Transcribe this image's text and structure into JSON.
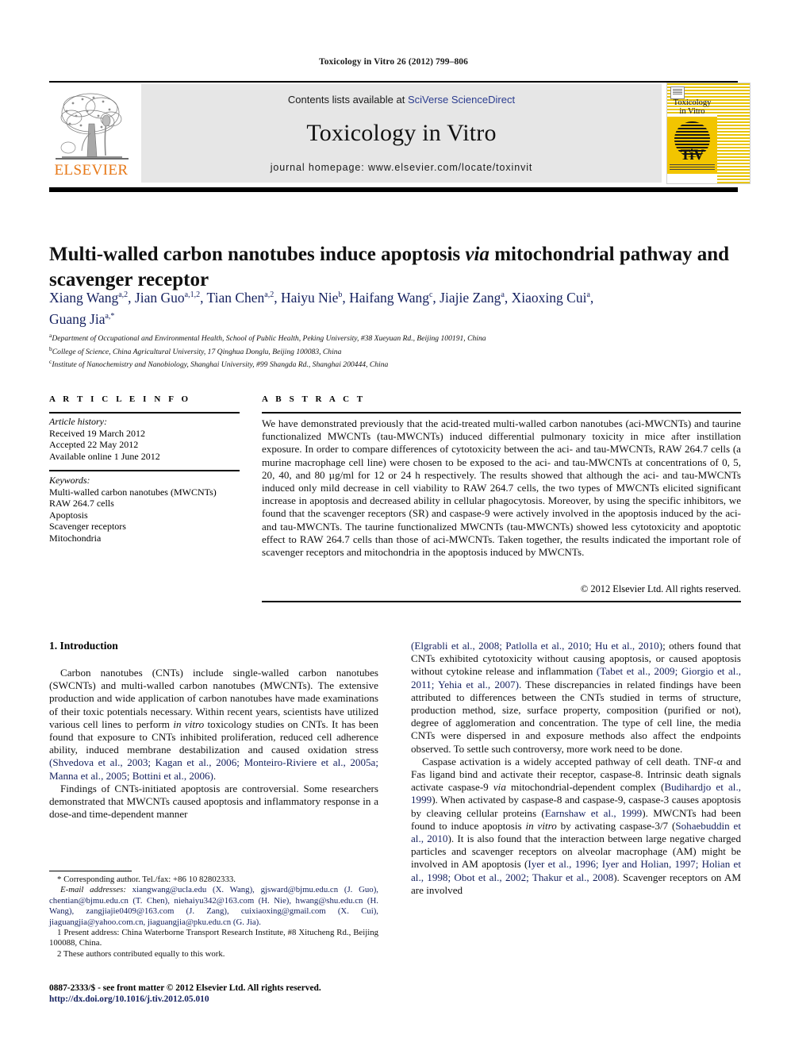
{
  "running_head": "Toxicology in Vitro 26 (2012) 799–806",
  "masthead": {
    "contents_prefix": "Contents lists available at ",
    "contents_link": "SciVerse ScienceDirect",
    "journal_title": "Toxicology in Vitro",
    "homepage": "journal homepage: www.elsevier.com/locate/toxinvit",
    "publisher_logo_text": "ELSEVIER",
    "cover": {
      "title_line1": "Toxicology",
      "title_line2": "in Vitro",
      "logo_text": "TiV"
    }
  },
  "article": {
    "title_part1": "Multi-walled carbon nanotubes induce apoptosis ",
    "title_italic": "via",
    "title_part2": " mitochondrial pathway and scavenger receptor",
    "authors_line1": "Xiang Wang a,2, Jian Guo a,1,2, Tian Chen a,2, Haiyu Nie b, Haifang Wang c, Jiajie Zang a, Xiaoxing Cui a,",
    "authors_line2": "Guang Jia a,*",
    "affiliations": [
      "a Department of Occupational and Environmental Health, School of Public Health, Peking University, #38 Xueyuan Rd., Beijing 100191, China",
      "b College of Science, China Agricultural University, 17 Qinghua Donglu, Beijing 100083, China",
      "c Institute of Nanochemistry and Nanobiology, Shanghai University, #99 Shangda Rd., Shanghai 200444, China"
    ]
  },
  "article_info": {
    "heading": "A R T I C L E  I N F O",
    "history_label": "Article history:",
    "history": [
      "Received 19 March 2012",
      "Accepted 22 May 2012",
      "Available online 1 June 2012"
    ],
    "keywords_label": "Keywords:",
    "keywords": [
      "Multi-walled carbon nanotubes (MWCNTs)",
      "RAW 264.7 cells",
      "Apoptosis",
      "Scavenger receptors",
      "Mitochondria"
    ]
  },
  "abstract": {
    "heading": "A B S T R A C T",
    "text": "We have demonstrated previously that the acid-treated multi-walled carbon nanotubes (aci-MWCNTs) and taurine functionalized MWCNTs (tau-MWCNTs) induced differential pulmonary toxicity in mice after instillation exposure. In order to compare differences of cytotoxicity between the aci- and tau-MWCNTs, RAW 264.7 cells (a murine macrophage cell line) were chosen to be exposed to the aci- and tau-MWCNTs at concentrations of 0, 5, 20, 40, and 80 µg/ml for 12 or 24 h respectively. The results showed that although the aci- and tau-MWCNTs induced only mild decrease in cell viability to RAW 264.7 cells, the two types of MWCNTs elicited significant increase in apoptosis and decreased ability in cellular phagocytosis. Moreover, by using the specific inhibitors, we found that the scavenger receptors (SR) and caspase-9 were actively involved in the apoptosis induced by the aci- and tau-MWCNTs. The taurine functionalized MWCNTs (tau-MWCNTs) showed less cytotoxicity and apoptotic effect to RAW 264.7 cells than those of aci-MWCNTs. Taken together, the results indicated the important role of scavenger receptors and mitochondria in the apoptosis induced by MWCNTs.",
    "copyright": "© 2012 Elsevier Ltd. All rights reserved."
  },
  "body": {
    "section_heading": "1. Introduction",
    "left_p1_a": "Carbon nanotubes (CNTs) include single-walled carbon nanotubes (SWCNTs) and multi-walled carbon nanotubes (MWCNTs). The extensive production and wide application of carbon nanotubes have made examinations of their toxic potentials necessary. Within recent years, scientists have utilized various cell lines to perform ",
    "left_p1_it": "in vitro",
    "left_p1_b": " toxicology studies on CNTs. It has been found that exposure to CNTs inhibited proliferation, reduced cell adherence ability, induced membrane destabilization and caused oxidation stress ",
    "left_p1_cite": "(Shvedova et al., 2003; Kagan et al., 2006; Monteiro-Riviere et al., 2005a; Manna et al., 2005; Bottini et al., 2006)",
    "left_p1_c": ".",
    "left_p2": "Findings of CNTs-initiated apoptosis are controversial. Some researchers demonstrated that MWCNTs caused apoptosis and inflammatory response in a dose-and time-dependent manner",
    "right_p1_cite1": "(Elgrabli et al., 2008; Patlolla et al., 2010; Hu et al., 2010)",
    "right_p1_a": "; others found that CNTs exhibited cytotoxicity without causing apoptosis, or caused apoptosis without cytokine release and inflammation ",
    "right_p1_cite2": "(Tabet et al., 2009; Giorgio et al., 2011; Yehia et al., 2007)",
    "right_p1_b": ". These discrepancies in related findings have been attributed to differences between the CNTs studied in terms of structure, production method, size, surface property, composition (purified or not), degree of agglomeration and concentration. The type of cell line, the media CNTs were dispersed in and exposure methods also affect the endpoints observed. To settle such controversy, more work need to be done.",
    "right_p2_a": "Caspase activation is a widely accepted pathway of cell death. TNF-α and Fas ligand bind and activate their receptor, caspase-8. Intrinsic death signals activate caspase-9 ",
    "right_p2_it1": "via",
    "right_p2_b": " mitochondrial-dependent complex (",
    "right_p2_cite1": "Budihardjo et al., 1999",
    "right_p2_c": "). When activated by caspase-8 and caspase-9, caspase-3 causes apoptosis by cleaving cellular proteins (",
    "right_p2_cite2": "Earnshaw et al., 1999",
    "right_p2_d": "). MWCNTs had been found to induce apoptosis ",
    "right_p2_it2": "in vitro",
    "right_p2_e": " by activating caspase-3/7 (",
    "right_p2_cite3": "Sohaebuddin et al., 2010",
    "right_p2_f": "). It is also found that the interaction between large negative charged particles and scavenger receptors on alveolar macrophage (AM) might be involved in AM apoptosis (",
    "right_p2_cite4": "Iyer et al., 1996; Iyer and Holian, 1997; Holian et al., 1998; Obot et al., 2002; Thakur et al., 2008",
    "right_p2_g": "). Scavenger receptors on AM are involved"
  },
  "footnotes": {
    "corresponding": "* Corresponding author. Tel./fax: +86 10 82802333.",
    "email_label": "E-mail addresses:",
    "emails": " xiangwang@ucla.edu (X. Wang), gjsward@bjmu.edu.cn (J. Guo), chentian@bjmu.edu.cn (T. Chen), niehaiyu342@163.com (H. Nie), hwang@shu.edu.cn (H. Wang), zangjiajie0409@163.com (J. Zang), cuixiaoxing@gmail.com (X. Cui), jiaguangjia@yahoo.com.cn, jiaguangjia@pku.edu.cn (G. Jia).",
    "note1": "1 Present address: China Waterborne Transport Research Institute, #8 Xitucheng Rd., Beijing 100088, China.",
    "note2": "2 These authors contributed equally to this work."
  },
  "footer": {
    "issn_line": "0887-2333/$ - see front matter © 2012 Elsevier Ltd. All rights reserved.",
    "doi": "http://dx.doi.org/10.1016/j.tiv.2012.05.010"
  },
  "colors": {
    "link_blue": "#2b3c8f",
    "cite_blue": "#14205e",
    "elsevier_orange": "#E77817",
    "band_gray": "#e6e6e6",
    "cover_yellow": "#F2C500"
  }
}
